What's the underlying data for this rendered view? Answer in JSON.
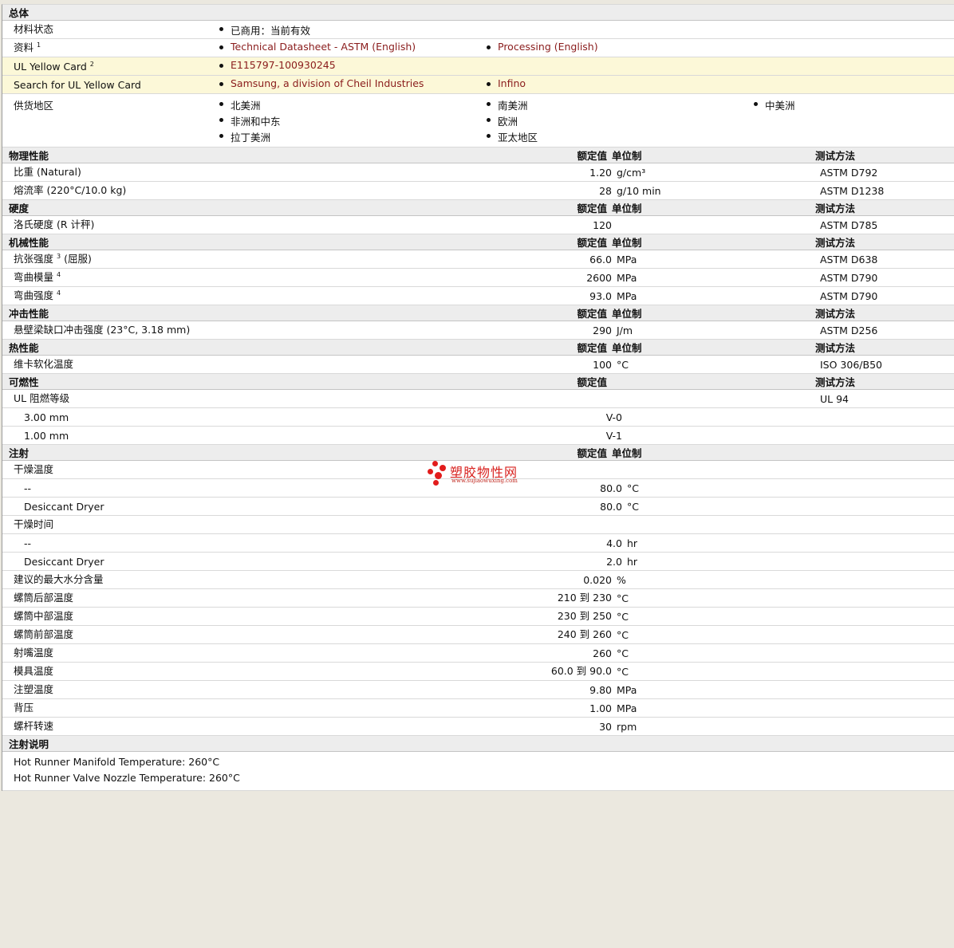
{
  "general": {
    "title": "总体",
    "status_label": "材料状态",
    "status_value": "已商用：当前有效",
    "docs_label": "资料",
    "docs_sup": "1",
    "docs": [
      "Technical Datasheet - ASTM (English)",
      "Processing (English)"
    ],
    "ul_label": "UL Yellow Card",
    "ul_sup": "2",
    "ul_value": "E115797-100930245",
    "search_label": "Search for UL Yellow Card",
    "search_links": [
      "Samsung, a division of Cheil Industries",
      "Infino"
    ],
    "supply_label": "供货地区",
    "supply_col1": [
      "北美洲",
      "非洲和中东",
      "拉丁美洲"
    ],
    "supply_col2": [
      "南美洲",
      "欧洲",
      "亚太地区"
    ],
    "supply_col3": [
      "中美洲"
    ]
  },
  "headers": {
    "nominal": "额定值",
    "unit": "单位制",
    "method": "测试方法"
  },
  "physical": {
    "title": "物理性能",
    "rows": [
      {
        "label": "比重  (Natural)",
        "value": "1.20",
        "unit": "g/cm³",
        "method": "ASTM D792"
      },
      {
        "label": "熔流率  (220°C/10.0 kg)",
        "value": "28",
        "unit": "g/10 min",
        "method": "ASTM D1238"
      }
    ]
  },
  "hardness": {
    "title": "硬度",
    "rows": [
      {
        "label": "洛氏硬度  (R 计秤)",
        "value": "120",
        "unit": "",
        "method": "ASTM D785"
      }
    ]
  },
  "mechanical": {
    "title": "机械性能",
    "rows": [
      {
        "label": "抗张强度",
        "sup": "3",
        "suffix": " (屈服)",
        "value": "66.0",
        "unit": "MPa",
        "method": "ASTM D638"
      },
      {
        "label": "弯曲模量",
        "sup": "4",
        "suffix": "",
        "value": "2600",
        "unit": "MPa",
        "method": "ASTM D790"
      },
      {
        "label": "弯曲强度",
        "sup": "4",
        "suffix": "",
        "value": "93.0",
        "unit": "MPa",
        "method": "ASTM D790"
      }
    ]
  },
  "impact": {
    "title": "冲击性能",
    "rows": [
      {
        "label": "悬壁梁缺口冲击强度  (23°C, 3.18 mm)",
        "value": "290",
        "unit": "J/m",
        "method": "ASTM D256"
      }
    ]
  },
  "thermal": {
    "title": "热性能",
    "rows": [
      {
        "label": "维卡软化温度",
        "value": "100",
        "unit": "°C",
        "method": "ISO 306/B50"
      }
    ]
  },
  "flammability": {
    "title": "可燃性",
    "rating_label": "UL 阻燃等级",
    "rating_method": "UL 94",
    "rows": [
      {
        "label": "3.00 mm",
        "value": "V-0"
      },
      {
        "label": "1.00 mm",
        "value": "V-1"
      }
    ]
  },
  "injection": {
    "title": "注射",
    "drying_temp_label": "干燥温度",
    "drying_temp_rows": [
      {
        "label": "--",
        "value": "80.0",
        "unit": "°C"
      },
      {
        "label": "Desiccant Dryer",
        "value": "80.0",
        "unit": "°C"
      }
    ],
    "drying_time_label": "干燥时间",
    "drying_time_rows": [
      {
        "label": "--",
        "value": "4.0",
        "unit": "hr"
      },
      {
        "label": "Desiccant Dryer",
        "value": "2.0",
        "unit": "hr"
      }
    ],
    "rows": [
      {
        "label": "建议的最大水分含量",
        "value": "0.020",
        "unit": "%"
      },
      {
        "label": "螺筒后部温度",
        "value": "210 到  230",
        "unit": "°C"
      },
      {
        "label": "螺筒中部温度",
        "value": "230 到  250",
        "unit": "°C"
      },
      {
        "label": "螺筒前部温度",
        "value": "240 到  260",
        "unit": "°C"
      },
      {
        "label": "射嘴温度",
        "value": "260",
        "unit": "°C"
      },
      {
        "label": "模具温度",
        "value": "60.0 到  90.0",
        "unit": "°C"
      },
      {
        "label": "注塑温度",
        "value": "9.80",
        "unit": "MPa"
      },
      {
        "label": "背压",
        "value": "1.00",
        "unit": "MPa"
      },
      {
        "label": "螺杆转速",
        "value": "30",
        "unit": "rpm"
      }
    ]
  },
  "injection_notes": {
    "title": "注射说明",
    "lines": [
      "Hot Runner Manifold Temperature: 260°C",
      "Hot Runner Valve Nozzle Temperature: 260°C"
    ]
  },
  "watermark": {
    "cn": "塑胶物性网",
    "en": "www.sujiaowuxing.com",
    "color": "#e21c1c"
  }
}
